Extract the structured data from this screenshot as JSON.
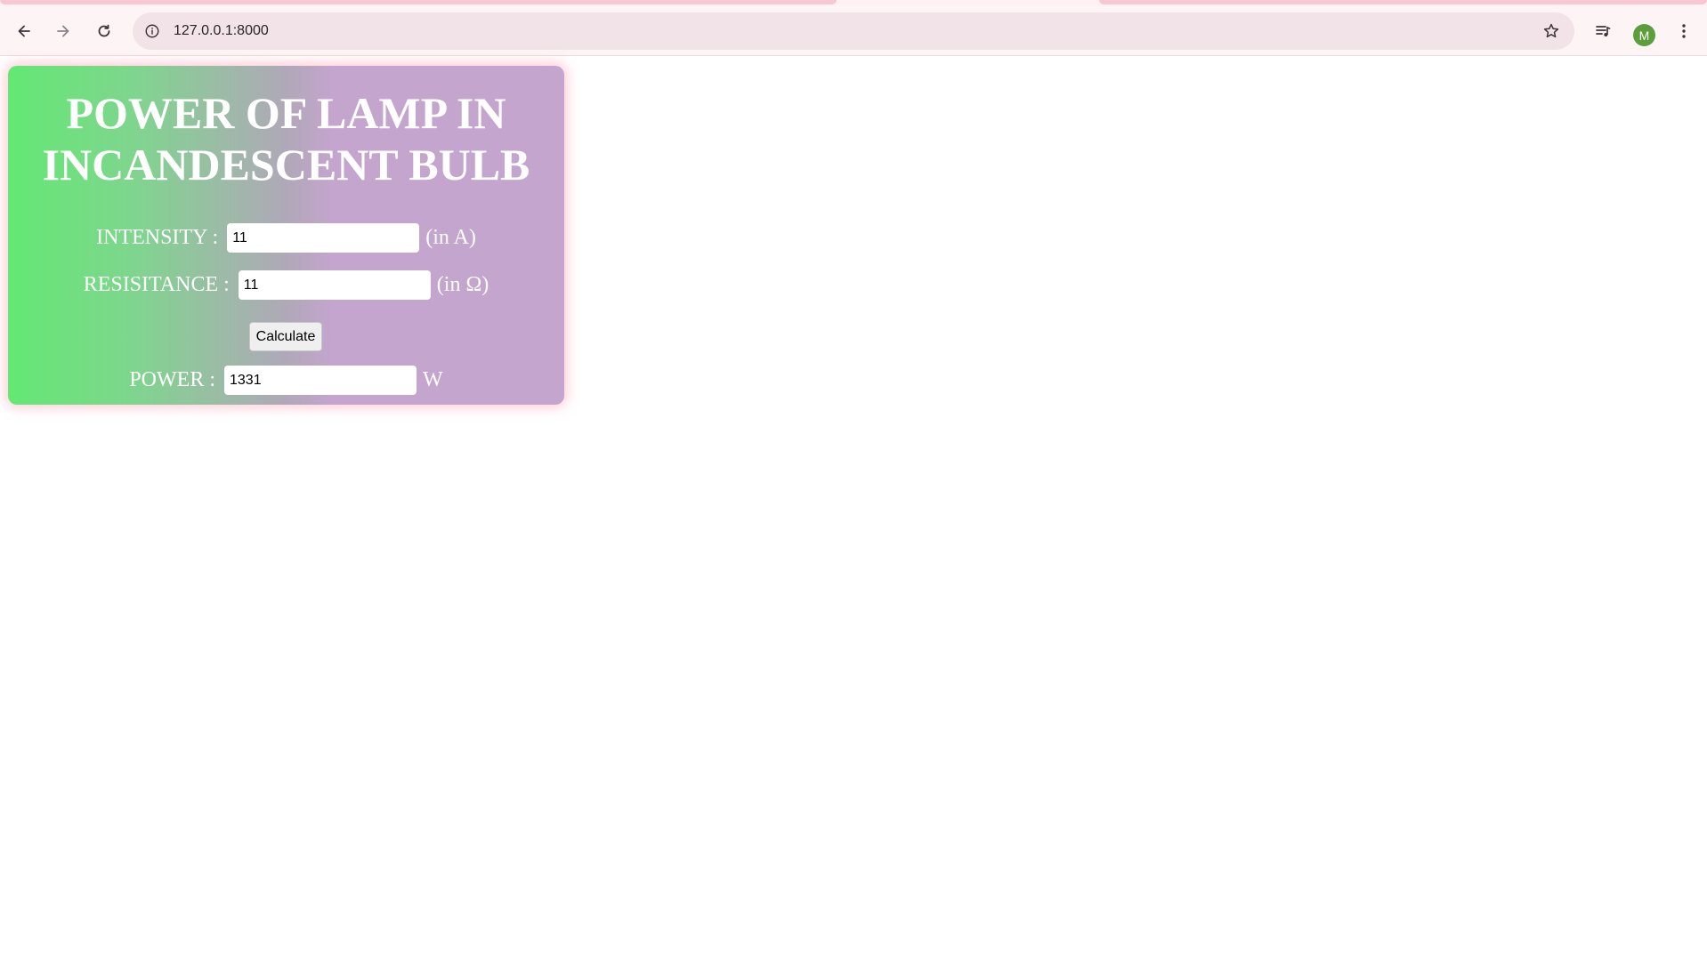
{
  "browser": {
    "url": "127.0.0.1:8000",
    "profile_initial": "M",
    "icons": {
      "back": "back-arrow-icon",
      "forward": "forward-arrow-icon",
      "reload": "reload-icon",
      "site_info": "info-icon",
      "bookmark": "star-icon",
      "media": "media-queue-icon",
      "menu": "kebab-menu-icon"
    },
    "colors": {
      "toolbar": "#fdf4f6",
      "omnibox": "#f1e3e8",
      "avatar": "#5b9e3b"
    }
  },
  "app": {
    "title_line1": "POWER OF LAMP IN",
    "title_line2": "INCANDESCENT BULB",
    "intensity": {
      "label": "INTENSITY :",
      "value": "11",
      "unit": "(in A)"
    },
    "resistance": {
      "label": "RESISITANCE :",
      "value": "11",
      "unit": "(in Ω)"
    },
    "calculate_label": "Calculate",
    "power": {
      "label": "POWER :",
      "value": "1331",
      "unit": "W"
    },
    "colors": {
      "gradient_start": "#63e873",
      "gradient_end": "#c3a5cd",
      "glow": "#ffa0b4",
      "text": "#ffffff"
    }
  }
}
